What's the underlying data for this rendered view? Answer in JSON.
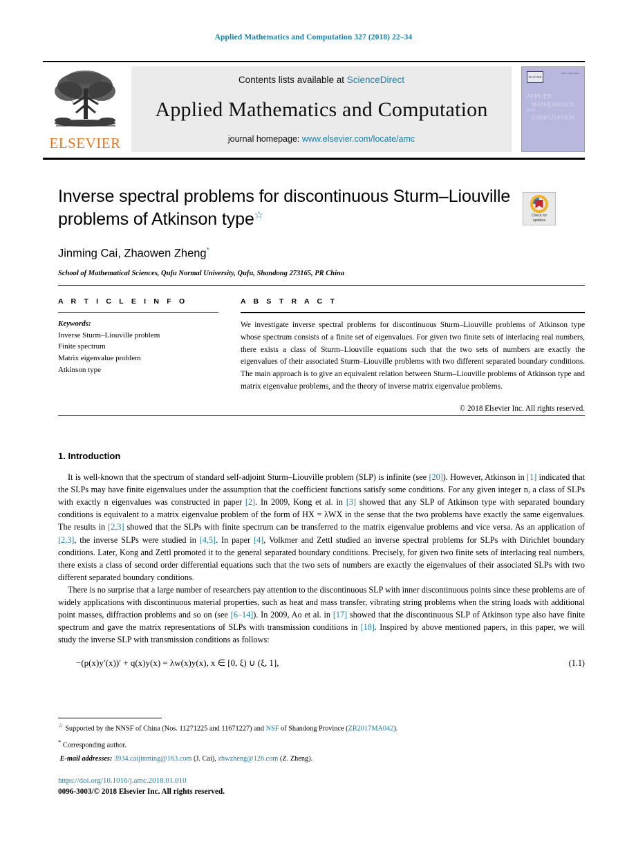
{
  "running_head": "Applied Mathematics and Computation 327 (2018) 22–34",
  "masthead": {
    "contents_prefix": "Contents lists available at ",
    "contents_link": "ScienceDirect",
    "journal_title": "Applied Mathematics and Computation",
    "homepage_prefix": "journal homepage: ",
    "homepage_link": "www.elsevier.com/locate/amc",
    "publisher_wordmark": "ELSEVIER",
    "cover": {
      "line1": "APPLIED",
      "line2": "MATHEMATICS",
      "line3": "AND",
      "line4": "COMPUTATION",
      "mark_label": "ELSEVIER",
      "issn_corner": "ISSN 0096-3003"
    }
  },
  "article": {
    "title": "Inverse spectral problems for discontinuous Sturm–Liouville problems of Atkinson type",
    "title_footnote_marker": "☆",
    "authors": "Jinming Cai, Zhaowen Zheng",
    "author_footnote_marker": "*",
    "affiliation": "School of Mathematical Sciences, Qufu Normal University, Qufu, Shandong 273165, PR China"
  },
  "crossmark": {
    "line1": "Check for",
    "line2": "updates"
  },
  "article_info": {
    "heading": "A R T I C L E   I N F O",
    "keywords_label": "Keywords:",
    "keywords": [
      "Inverse Sturm–Liouville problem",
      "Finite spectrum",
      "Matrix eigenvalue problem",
      "Atkinson type"
    ]
  },
  "abstract": {
    "heading": "A B S T R A C T",
    "text": "We investigate inverse spectral problems for discontinuous Sturm–Liouville problems of Atkinson type whose spectrum consists of a finite set of eigenvalues. For given two finite sets of interlacing real numbers, there exists a class of Sturm–Liouville equations such that the two sets of numbers are exactly the eigenvalues of their associated Sturm–Liouville problems with two different separated boundary conditions. The main approach is to give an equivalent relation between Sturm–Liouville problems of Atkinson type and matrix eigenvalue problems, and the theory of inverse matrix eigenvalue problems.",
    "copyright": "© 2018 Elsevier Inc. All rights reserved."
  },
  "introduction": {
    "heading": "1. Introduction",
    "paragraph1_parts": [
      "It is well-known that the spectrum of standard self-adjoint Sturm–Liouville problem (SLP) is infinite (see ",
      "[20]",
      "). However, Atkinson in ",
      "[1]",
      " indicated that the SLPs may have finite eigenvalues under the assumption that the coefficient functions satisfy some conditions. For any given integer n, a class of SLPs with exactly n eigenvalues was constructed in paper ",
      "[2]",
      ". In 2009, Kong et al. in ",
      "[3]",
      " showed that any SLP of Atkinson type with separated boundary conditions is equivalent to a matrix eigenvalue problem of the form of HX = λWX in the sense that the two problems have exactly the same eigenvalues. The results in ",
      "[2,3]",
      " showed that the SLPs with finite spectrum can be transferred to the matrix eigenvalue problems and vice versa. As an application of ",
      "[2,3]",
      ", the inverse SLPs were studied in ",
      "[4,5]",
      ". In paper ",
      "[4]",
      ", Volkmer and Zettl studied an inverse spectral problems for SLPs with Dirichlet boundary conditions. Later, Kong and Zettl promoted it to the general separated boundary conditions. Precisely, for given two finite sets of interlacing real numbers, there exists a class of second order differential equations such that the two sets of numbers are exactly the eigenvalues of their associated SLPs with two different separated boundary conditions."
    ],
    "paragraph2_parts": [
      "There is no surprise that a large number of researchers pay attention to the discontinuous SLP with inner discontinuous points since these problems are of widely applications with discontinuous material properties, such as heat and mass transfer, vibrating string problems when the string loads with additional point masses, diffraction problems and so on (see ",
      "[6–14]",
      "). In 2009, Ao et al. in ",
      "[17]",
      " showed that the discontinuous SLP of Atkinson type also have finite spectrum and gave the matrix representations of SLPs with transmission conditions in ",
      "[18]",
      ". Inspired by above mentioned papers, in this paper, we will study the inverse SLP with transmission conditions as follows:"
    ],
    "equation": "−(p(x)y′(x))′ + q(x)y(x) = λw(x)y(x),   x ∈ [0, ξ) ∪ (ξ, 1],",
    "equation_number": "(1.1)"
  },
  "footnotes": {
    "funding_marker": "☆",
    "funding_parts": [
      "Supported by the NNSF of China (Nos. 11271225 and 11671227) and ",
      "NSF",
      " of Shandong Province (",
      "ZR2017MA042",
      ")."
    ],
    "corresponding_marker": "*",
    "corresponding_text": "Corresponding author.",
    "email_label": "E-mail addresses:",
    "emails": [
      {
        "address": "3934.caijinming@163.com",
        "person": "(J. Cai)"
      },
      {
        "address": "zhwzheng@126.com",
        "person": "(Z. Zheng)"
      }
    ],
    "doi": "https://doi.org/10.1016/j.amc.2018.01.010",
    "issn_line": "0096-3003/© 2018 Elsevier Inc. All rights reserved."
  },
  "colors": {
    "link": "#1a7fa8",
    "elsevier_orange": "#E87722",
    "panel_gray": "#ebebeb",
    "cover_purple": "#b8b7de"
  }
}
